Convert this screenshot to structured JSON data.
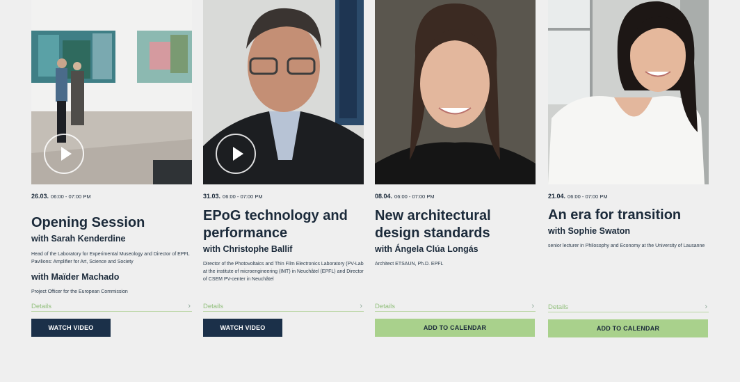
{
  "events": [
    {
      "date": "26.03.",
      "time": "06:00 - 07:00 PM",
      "title": "Opening Session",
      "speakers": [
        {
          "with": "with Sarah Kenderdine",
          "desc": "Head of the Laboratory for Experimental Museology and Director of EPFL Pavilions: Amplifier for Art, Science and Society"
        },
        {
          "with": "with Maïder Machado",
          "desc": "Project Officer for the European Commission"
        }
      ],
      "details": "Details",
      "button": "WATCH VIDEO",
      "has_video": true,
      "image_icon": "gallery-photo"
    },
    {
      "date": "31.03.",
      "time": "06:00 - 07:00 PM",
      "title": "EPoG technology and performance",
      "speakers": [
        {
          "with": "with Christophe Ballif",
          "desc": "Director of the Photovoltaics and Thin Film Electronics Laboratory (PV-Lab at the institute of microengineering (IMT) in Neuchâtel (EPFL) and Director of CSEM PV-center in Neuchâtel"
        }
      ],
      "details": "Details",
      "button": "WATCH VIDEO",
      "has_video": true,
      "image_icon": "portrait-photo"
    },
    {
      "date": "08.04.",
      "time": "06:00 - 07:00 PM",
      "title": "New architectural design standards",
      "speakers": [
        {
          "with": "with Ángela Clúa Longás",
          "desc": "Architect ETSAUN, Ph.D. EPFL"
        }
      ],
      "details": "Details",
      "button": "ADD TO CALENDAR",
      "has_video": false,
      "image_icon": "portrait-photo"
    },
    {
      "date": "21.04.",
      "time": "06:00 - 07:00 PM",
      "title": "An era for transition",
      "speakers": [
        {
          "with": "with Sophie Swaton",
          "desc": "senior lecturer in Philosophy and Economy at the University of Lausanne"
        }
      ],
      "details": "Details",
      "button": "ADD TO CALENDAR",
      "has_video": false,
      "image_icon": "portrait-photo"
    }
  ],
  "colors": {
    "dark_button": "#1b3049",
    "green_button": "#a9d18c",
    "details_green": "#93c07e",
    "background": "#efefef"
  }
}
